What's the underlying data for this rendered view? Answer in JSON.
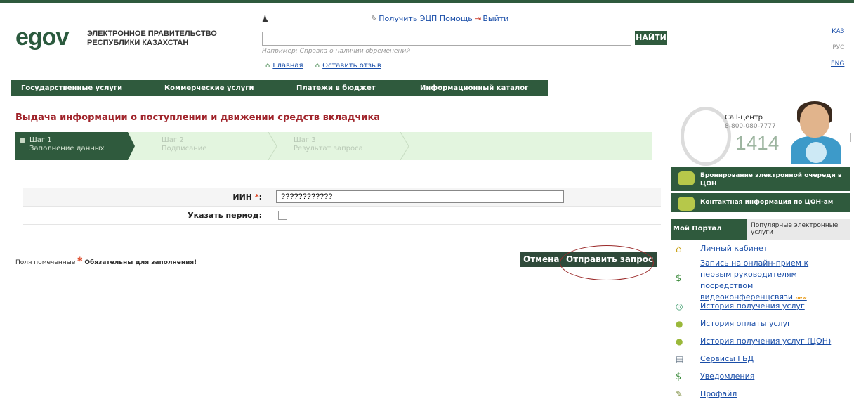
{
  "brand": {
    "logo_text": "egov",
    "name_line1": "ЭЛЕКТРОННОЕ ПРАВИТЕЛЬСТВО",
    "name_line2": "РЕСПУБЛИКИ КАЗАХСТАН"
  },
  "header": {
    "links": [
      "Получить ЭЦП",
      "Помощь",
      "Выйти"
    ],
    "search": {
      "value": "",
      "button": "НАЙТИ",
      "hint": "Например: Справка о наличии обременений"
    },
    "subnav": [
      "Главная",
      "Оставить отзыв"
    ],
    "languages": [
      "КАЗ",
      "РУС",
      "ENG"
    ],
    "active_language": "РУС"
  },
  "mainnav": [
    "Государственные услуги",
    "Коммерческие услуги",
    "Платежи в бюджет",
    "Информационный каталог"
  ],
  "page": {
    "title": "Выдача информации о поступлении и движении средств вкладчика",
    "steps": [
      {
        "num": "Шаг 1",
        "name": "Заполнение данных"
      },
      {
        "num": "Шаг 2",
        "name": "Подписание"
      },
      {
        "num": "Шаг 3",
        "name": "Результат запроса"
      }
    ],
    "form": {
      "iin_label": "ИИН",
      "iin_value": "????????????",
      "period_label": "Указать период:"
    },
    "note_prefix": "Поля помеченные",
    "note_bold": "Обязательны для заполнения!",
    "cancel": "Отмена",
    "submit": "Отправить запрос"
  },
  "sidebar": {
    "call_label": "Call-центр",
    "call_number": "8-800-080-7777",
    "call_short": "1414",
    "booking": "Бронирование электронной очереди в ЦОН",
    "contacts": "Контактная информация по ЦОН-ам",
    "tab_my": "Мой Портал",
    "tab_popular": "Популярные электронные услуги",
    "items": [
      "Личный кабинет",
      "Запись на онлайн-прием к первым руководителям посредством видеоконференцсвязи",
      "История получения услуг",
      "История оплаты услуг",
      "История получения услуг (ЦОН)",
      "Сервисы ГБД",
      "Уведомления",
      "Профайл"
    ],
    "new_badge": "new"
  },
  "colors": {
    "primary": "#2f5a3d",
    "title": "#a0242b",
    "link": "#1a4ea8",
    "steps_bg": "#e3f5df",
    "highlight": "#9b2a2a"
  }
}
